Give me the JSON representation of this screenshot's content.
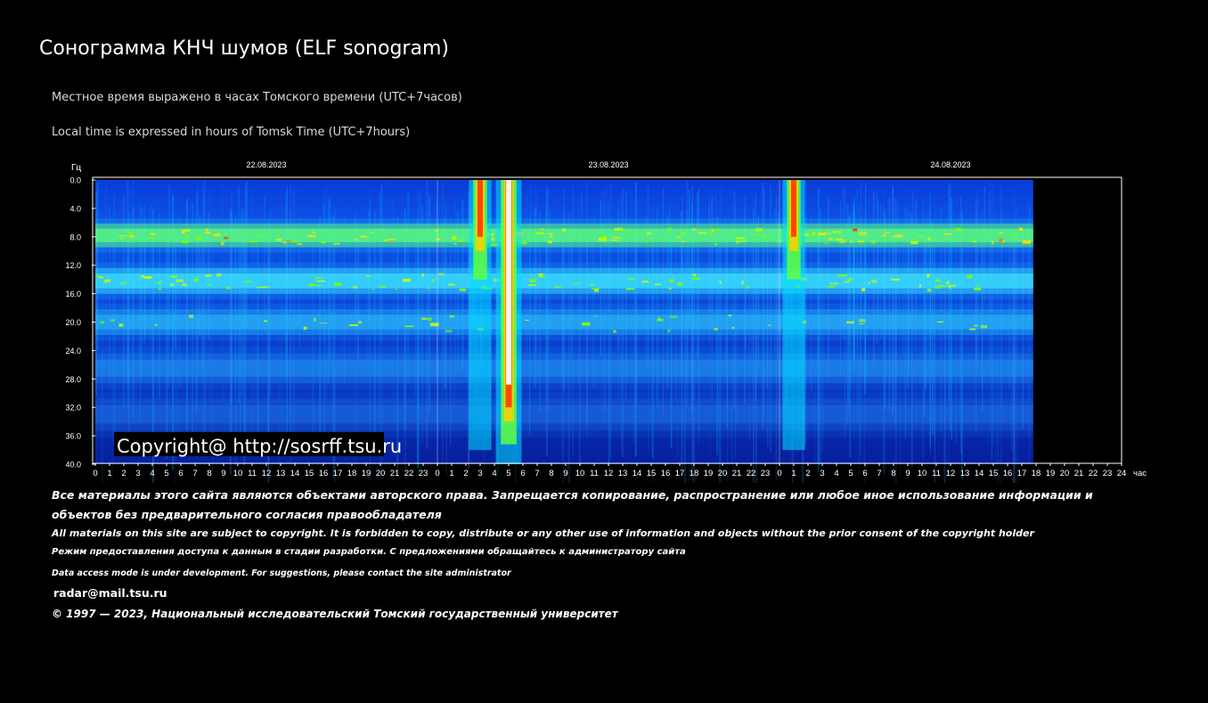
{
  "page": {
    "title": "Сонограмма КНЧ шумов (ELF sonogram)",
    "note_ru": "Местное время выражено в часах Томского времени (UTC+7часов)",
    "note_en": "Local time is expressed in hours of Tomsk Time (UTC+7hours)"
  },
  "chart_data": {
    "type": "heatmap",
    "title": "",
    "ylabel": "Гц",
    "xlabel": "час",
    "ylim": [
      0,
      40
    ],
    "y_ticks": [
      "0.0",
      "4.0",
      "8.0",
      "12.0",
      "16.0",
      "20.0",
      "24.0",
      "28.0",
      "32.0",
      "36.0",
      "40.0"
    ],
    "x_ticks": [
      "0",
      "1",
      "2",
      "3",
      "4",
      "5",
      "6",
      "7",
      "8",
      "9",
      "10",
      "11",
      "12",
      "13",
      "14",
      "15",
      "16",
      "17",
      "18",
      "19",
      "20",
      "21",
      "22",
      "23",
      "0",
      "1",
      "2",
      "3",
      "4",
      "5",
      "6",
      "7",
      "8",
      "9",
      "10",
      "11",
      "12",
      "13",
      "14",
      "15",
      "16",
      "17",
      "18",
      "19",
      "20",
      "21",
      "22",
      "23",
      "0",
      "1",
      "2",
      "3",
      "4",
      "5",
      "6",
      "7",
      "8",
      "9",
      "10",
      "11",
      "12",
      "13",
      "14",
      "15",
      "16",
      "17",
      "18",
      "19",
      "20",
      "21",
      "22",
      "23",
      "24"
    ],
    "dates": [
      {
        "label": "22.08.2023",
        "start_hour": 0
      },
      {
        "label": "23.08.2023",
        "start_hour": 24
      },
      {
        "label": "24.08.2023",
        "start_hour": 48
      }
    ],
    "data_end_hour": 65.8,
    "total_hours": 72,
    "resonance_bands_hz": [
      7.8,
      14.2,
      20.0,
      26.5,
      33.0
    ],
    "bursts_hour": [
      27.0,
      29.0,
      49.0
    ],
    "watermark": "Copyright@ http://sosrff.tsu.ru",
    "colors": {
      "background": "#000000",
      "low": "#00008c",
      "mid": "#00c8ff",
      "high": "#80ff00",
      "peak": "#ff3000",
      "max": "#ffffff"
    }
  },
  "footer": {
    "copyright_ru": "Все материалы этого сайта являются объектами авторского права. Запрещается копирование, распространение или любое иное использование информации и объектов без предварительного согласия правообладателя",
    "copyright_en": "All materials on this site are subject to copyright. It is forbidden to copy, distribute or any other use of information and objects without the prior consent of the copyright holder",
    "access_ru": "Режим предоставления доступа к данным в стадии разработки. С предложениями обращайтесь к администратору сайта",
    "access_en": "Data access mode is under development. For suggestions, please contact the site administrator",
    "email": "radar@mail.tsu.ru",
    "university": "© 1997 — 2023, Национальный исследовательский Томский государственный университет"
  }
}
